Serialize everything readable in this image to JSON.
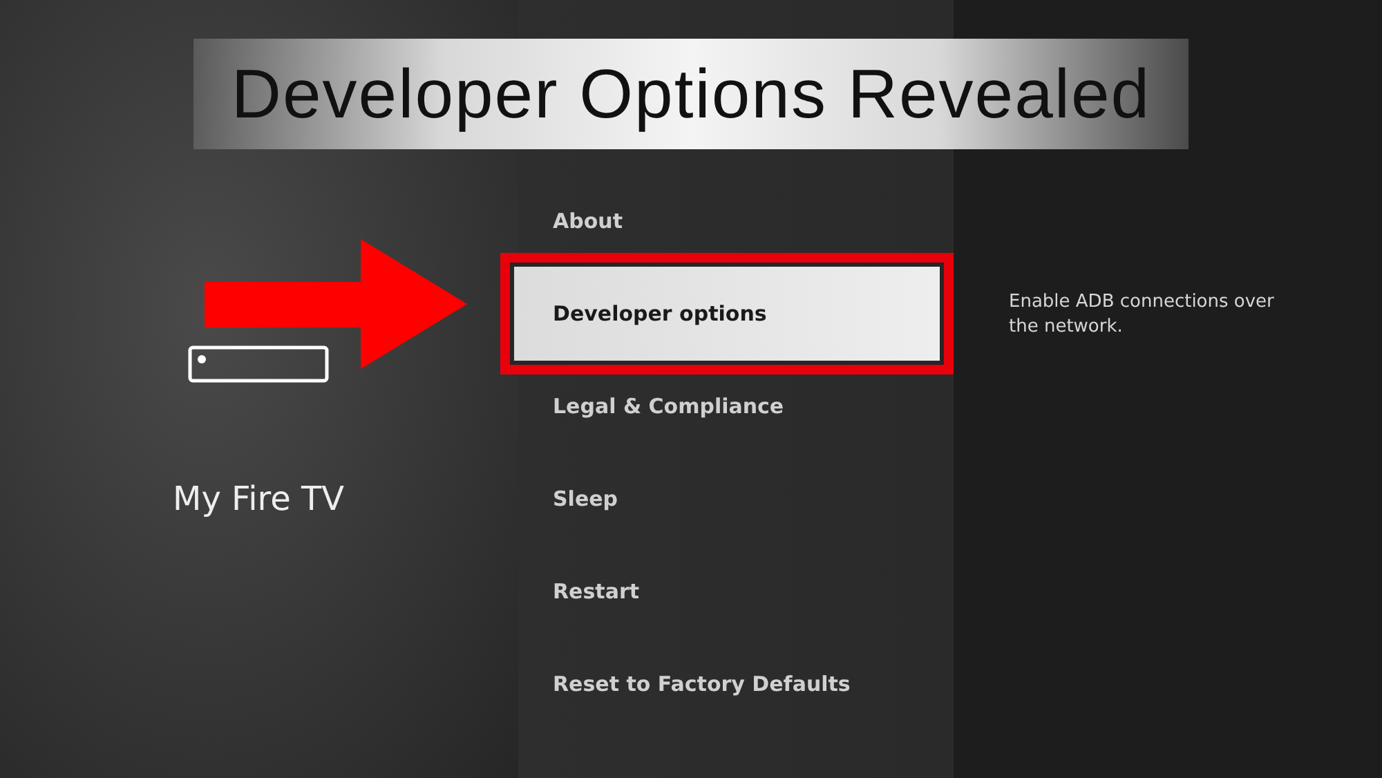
{
  "banner": {
    "title": "Developer Options Revealed"
  },
  "arrow": {
    "shown": true
  },
  "section": {
    "title": "My Fire TV"
  },
  "menu": [
    {
      "label": "About",
      "selected": false,
      "highlighted": false
    },
    {
      "label": "Developer options",
      "selected": true,
      "highlighted": true
    },
    {
      "label": "Legal & Compliance",
      "selected": false,
      "highlighted": false
    },
    {
      "label": "Sleep",
      "selected": false,
      "highlighted": false
    },
    {
      "label": "Restart",
      "selected": false,
      "highlighted": false
    },
    {
      "label": "Reset to Factory Defaults",
      "selected": false,
      "highlighted": false
    }
  ],
  "description": "Enable ADB connections over the network."
}
